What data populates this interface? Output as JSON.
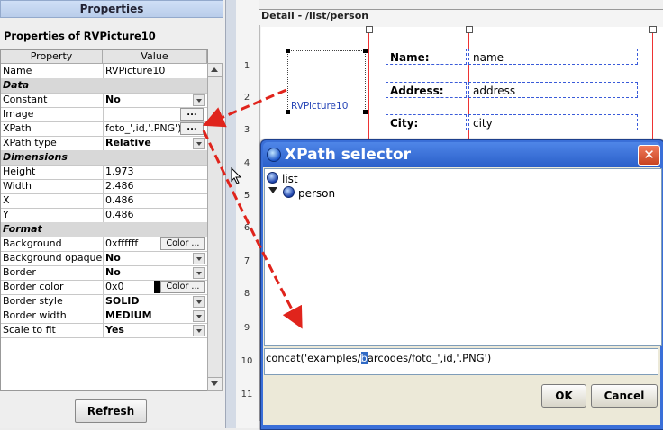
{
  "props_panel": {
    "title": "Properties",
    "subtitle": "Properties of RVPicture10",
    "col_property": "Property",
    "col_value": "Value",
    "rows": [
      {
        "key": "Name",
        "value": "RVPicture10",
        "type": "text"
      },
      {
        "key": "Data",
        "value": "",
        "type": "section"
      },
      {
        "key": "Constant",
        "value": "No",
        "type": "dropdown"
      },
      {
        "key": "Image",
        "value": "",
        "type": "dots"
      },
      {
        "key": "XPath",
        "value": "foto_',id,'.PNG')",
        "type": "dots"
      },
      {
        "key": "XPath type",
        "value": "Relative",
        "type": "dropdown"
      },
      {
        "key": "Dimensions",
        "value": "",
        "type": "section"
      },
      {
        "key": "Height",
        "value": "1.973",
        "type": "text"
      },
      {
        "key": "Width",
        "value": "2.486",
        "type": "text"
      },
      {
        "key": "X",
        "value": "0.486",
        "type": "text"
      },
      {
        "key": "Y",
        "value": "0.486",
        "type": "text"
      },
      {
        "key": "Format",
        "value": "",
        "type": "section"
      },
      {
        "key": "Background",
        "value": "0xffffff",
        "type": "color"
      },
      {
        "key": "Background opaque",
        "value": "No",
        "type": "dropdown"
      },
      {
        "key": "Border",
        "value": "No",
        "type": "dropdown"
      },
      {
        "key": "Border color",
        "value": "0x0",
        "type": "color-swatch"
      },
      {
        "key": "Border style",
        "value": "SOLID",
        "type": "dropdown"
      },
      {
        "key": "Border width",
        "value": "MEDIUM",
        "type": "dropdown"
      },
      {
        "key": "Scale to fit",
        "value": "Yes",
        "type": "dropdown"
      }
    ],
    "dots_label": "...",
    "color_button": "Color ...",
    "refresh_label": "Refresh"
  },
  "design": {
    "detail_label": "Detail - /list/person",
    "ruler_numbers": [
      "1",
      "2",
      "3",
      "4",
      "5",
      "6",
      "7",
      "8",
      "9",
      "10",
      "11"
    ],
    "picture_label": "RVPicture10",
    "fields": [
      {
        "label": "Name:",
        "value": "name"
      },
      {
        "label": "Address:",
        "value": "address"
      },
      {
        "label": "City:",
        "value": "city"
      }
    ]
  },
  "dialog": {
    "title": "XPath selector",
    "close_symbol": "✕",
    "tree": [
      {
        "label": "list",
        "level": 0
      },
      {
        "label": "person",
        "level": 1
      }
    ],
    "xpath_prefix": "concat('examples/",
    "xpath_selected": "b",
    "xpath_suffix": "arcodes/foto_',id,'.PNG')",
    "ok_label": "OK",
    "cancel_label": "Cancel"
  },
  "colors": {
    "accent": "#3a6fd8",
    "arrow": "#e0241c",
    "field_border": "#3a5bd9"
  }
}
